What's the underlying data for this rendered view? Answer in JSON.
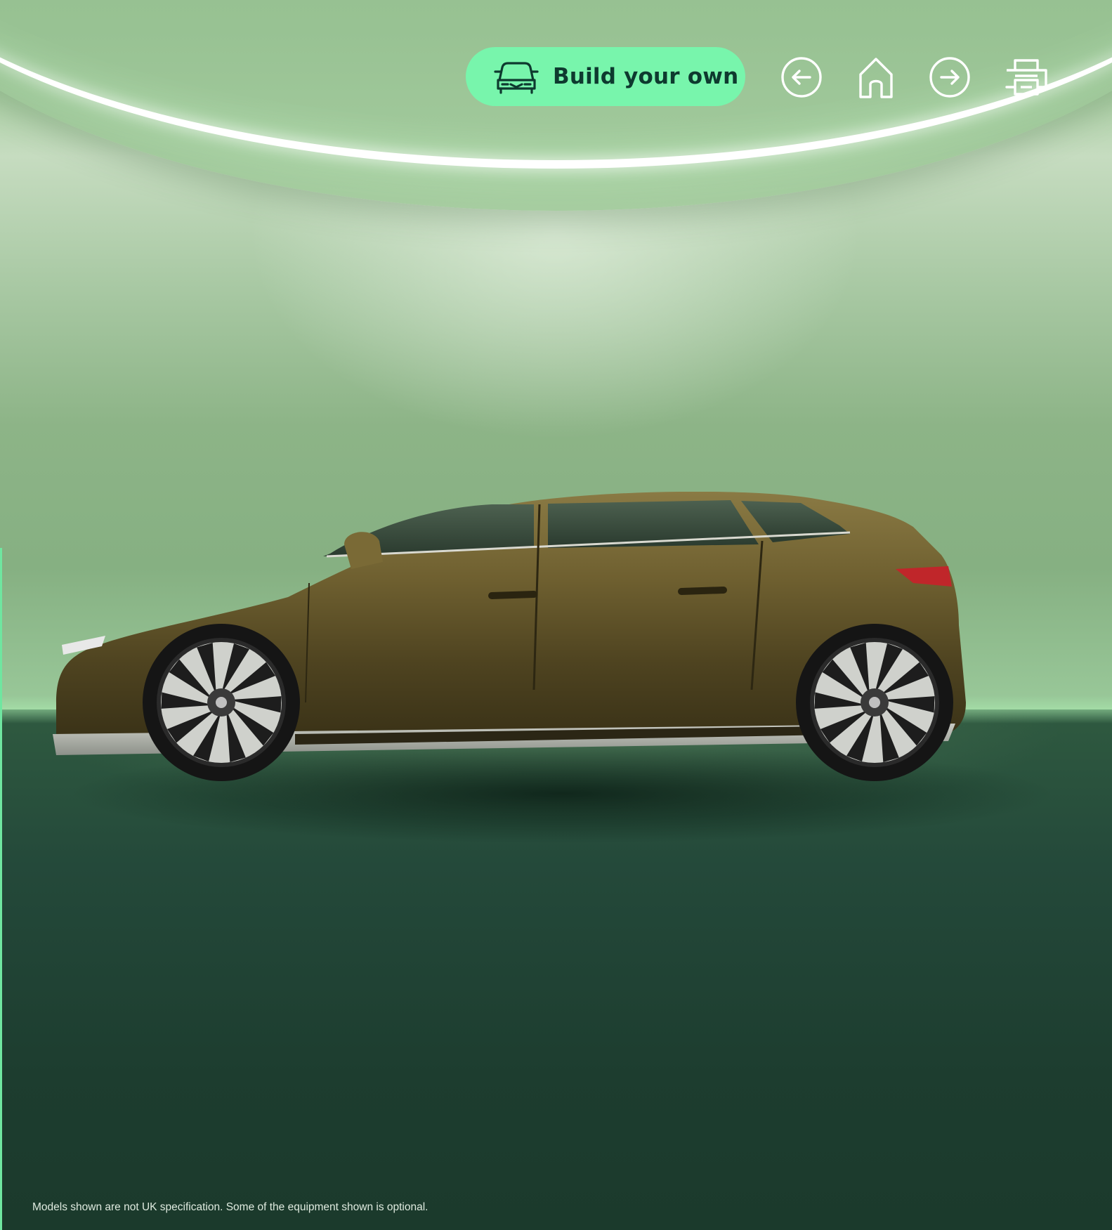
{
  "toolbar": {
    "build_label": "Build your own",
    "build_icon": "car-front-icon",
    "back_icon": "arrow-left-circle-icon",
    "home_icon": "home-icon",
    "forward_icon": "arrow-right-circle-icon",
    "print_icon": "printer-icon"
  },
  "hero": {
    "image_subject": "car-side-view",
    "car_color": "#6b5a2c"
  },
  "colors": {
    "accent": "#78f5ac",
    "accent_text": "#0e3a2f",
    "icon_stroke": "#ffffff"
  },
  "footer": {
    "disclaimer": "Models shown are not UK specification. Some of the equipment shown is optional."
  }
}
